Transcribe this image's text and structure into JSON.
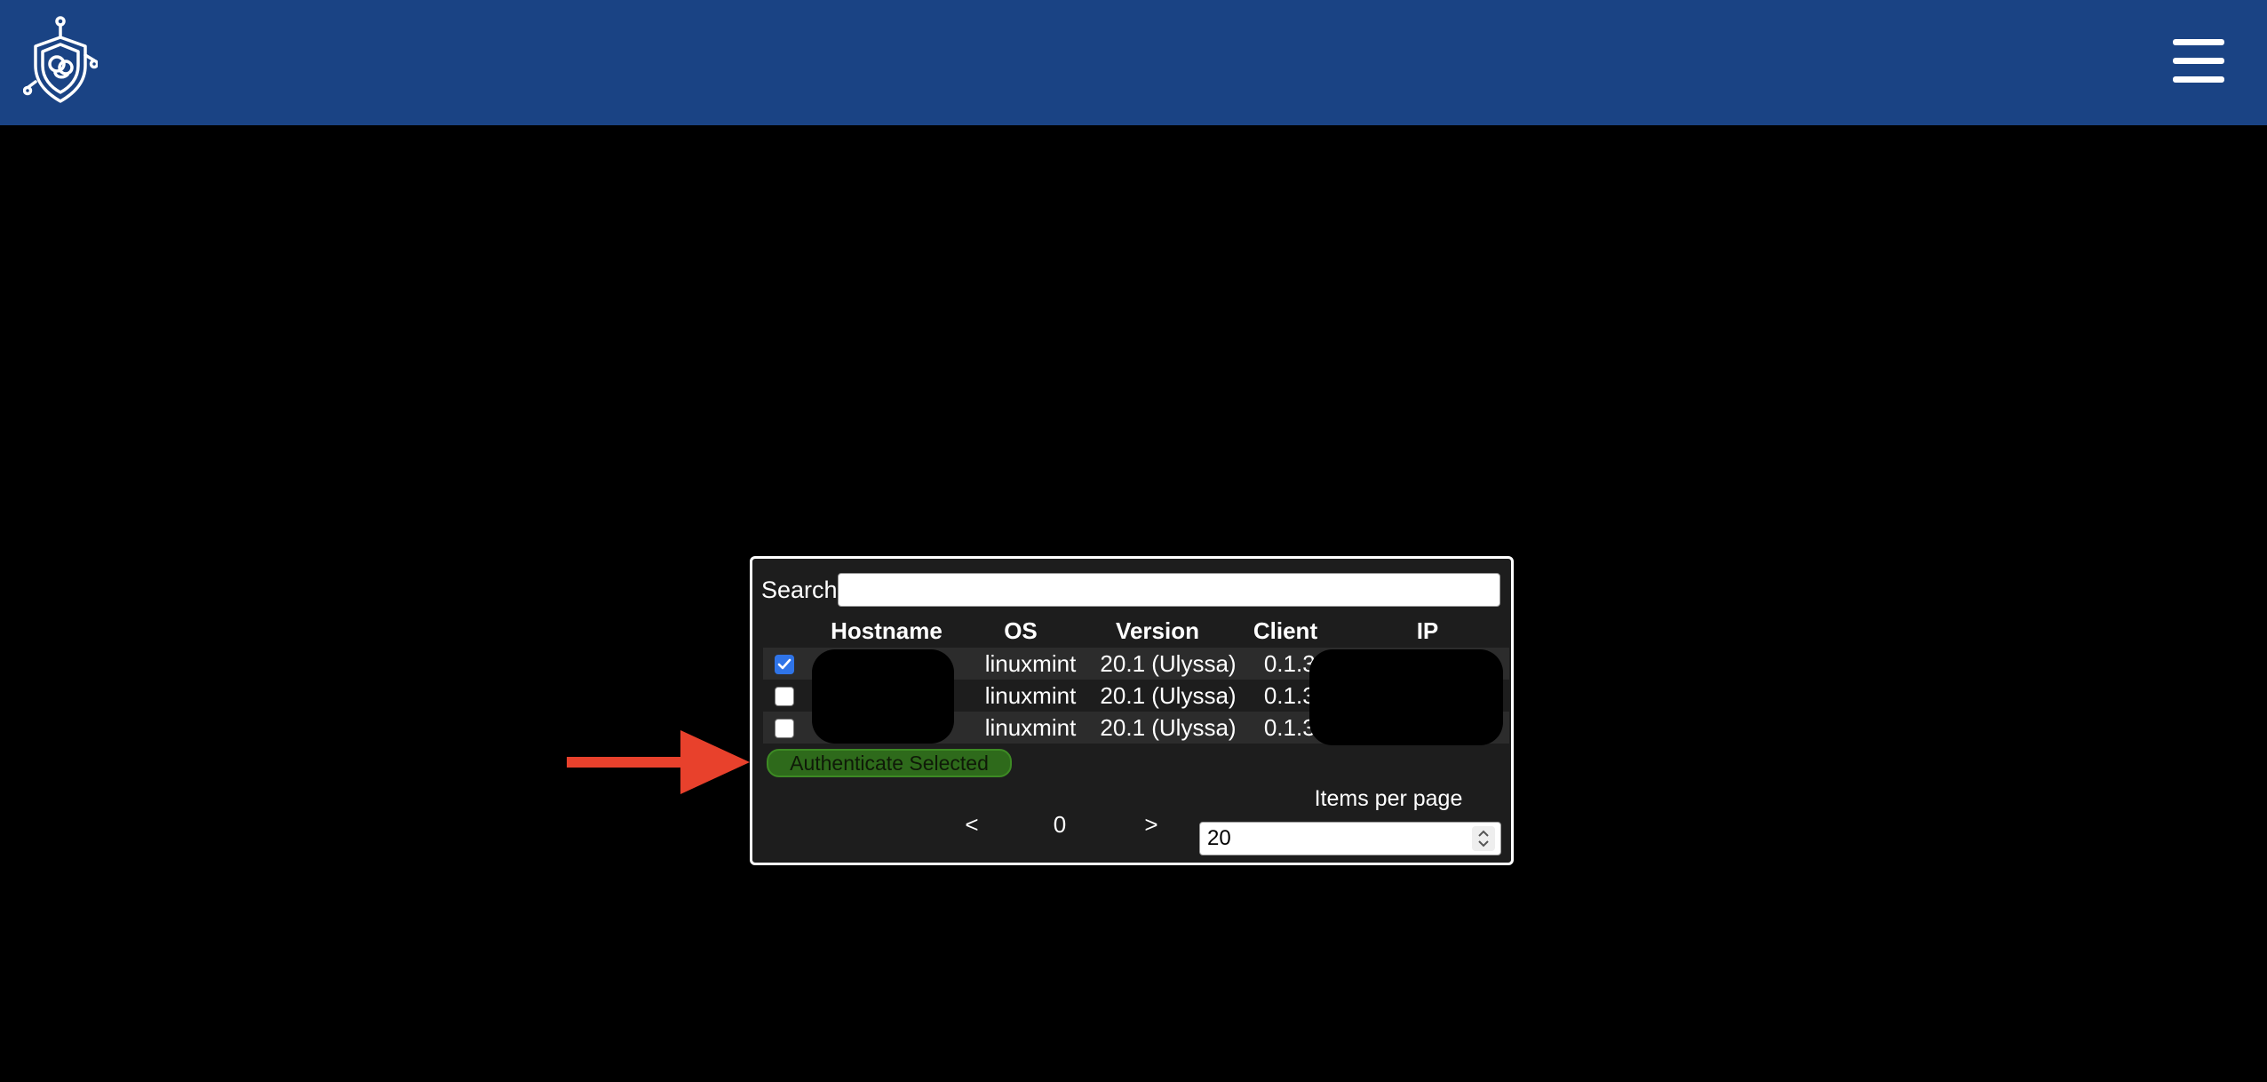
{
  "header": {
    "bg_color": "#1a4384",
    "logo_icon": "shield-logo-icon",
    "menu_icon": "hamburger-menu-icon"
  },
  "search": {
    "label": "Search",
    "value": "",
    "placeholder": ""
  },
  "table": {
    "columns": [
      "Hostname",
      "OS",
      "Version",
      "Client",
      "IP"
    ],
    "rows": [
      {
        "checked": true,
        "hostname": "",
        "os": "linuxmint",
        "version": "20.1 (Ulyssa)",
        "client": "0.1.30",
        "ip": ""
      },
      {
        "checked": false,
        "hostname": "",
        "os": "linuxmint",
        "version": "20.1 (Ulyssa)",
        "client": "0.1.30",
        "ip": ""
      },
      {
        "checked": false,
        "hostname": "",
        "os": "linuxmint",
        "version": "20.1 (Ulyssa)",
        "client": "0.1.30",
        "ip": ""
      }
    ]
  },
  "actions": {
    "authenticate_label": "Authenticate Selected",
    "authenticate_color": "#2e6a1b"
  },
  "pagination": {
    "prev": "<",
    "page": "0",
    "next": ">",
    "items_per_page_label": "Items per page",
    "items_per_page_value": "20"
  },
  "annotation": {
    "arrow_color": "#e8412c"
  }
}
